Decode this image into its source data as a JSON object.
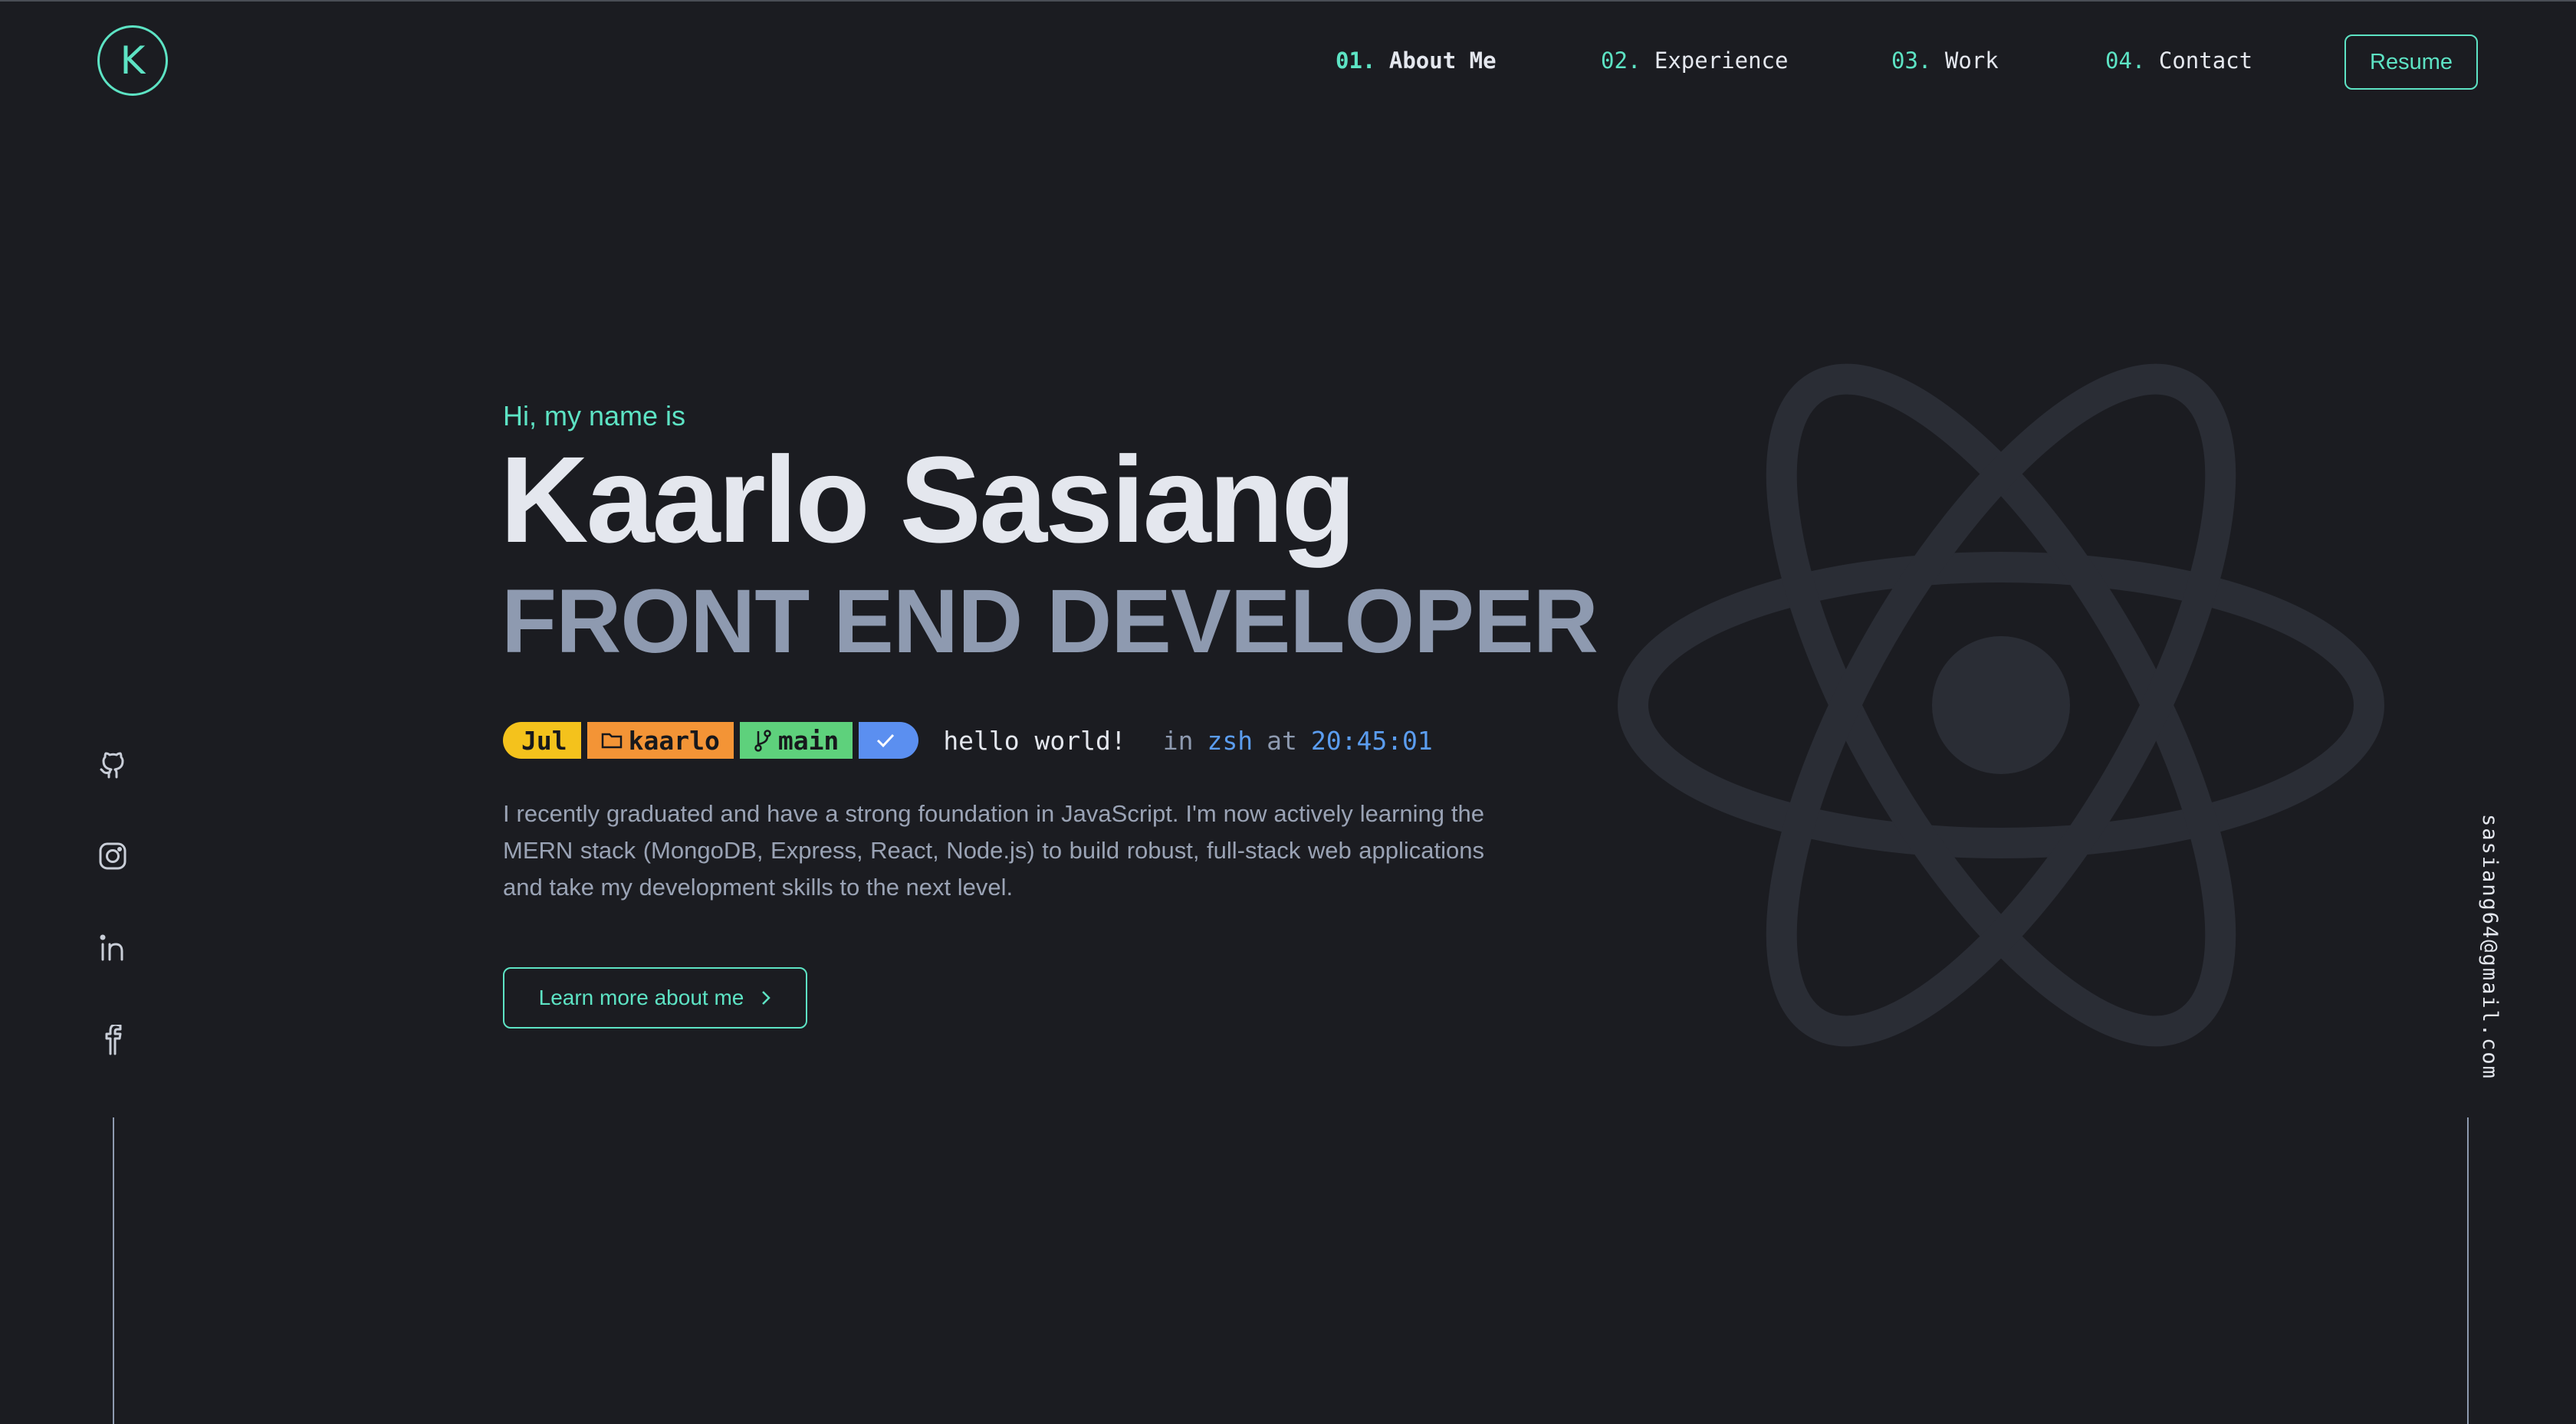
{
  "brand": {
    "logo_letter": "K",
    "accent": "#5de3c4"
  },
  "nav": {
    "items": [
      {
        "num": "01.",
        "label": "About Me"
      },
      {
        "num": "02.",
        "label": "Experience"
      },
      {
        "num": "03.",
        "label": "Work"
      },
      {
        "num": "04.",
        "label": "Contact"
      }
    ],
    "resume_label": "Resume"
  },
  "hero": {
    "greeting": "Hi, my name is",
    "name": "Kaarlo Sasiang",
    "role": "FRONT END DEVELOPER",
    "prompt": {
      "date": "Jul",
      "dir": "kaarlo",
      "branch": "main",
      "message": "hello world!",
      "in_label": "in",
      "shell": "zsh",
      "at_label": "at",
      "time": "20:45:01"
    },
    "description": "I recently graduated and have a strong foundation in JavaScript. I'm now actively learning the MERN stack (MongoDB, Express, React, Node.js) to build robust, full-stack web applications and take my development skills to the next level.",
    "cta_label": "Learn more about me"
  },
  "social": [
    "github-icon",
    "instagram-icon",
    "linkedin-icon",
    "facebook-icon"
  ],
  "email": "sasiang64@gmail.com"
}
